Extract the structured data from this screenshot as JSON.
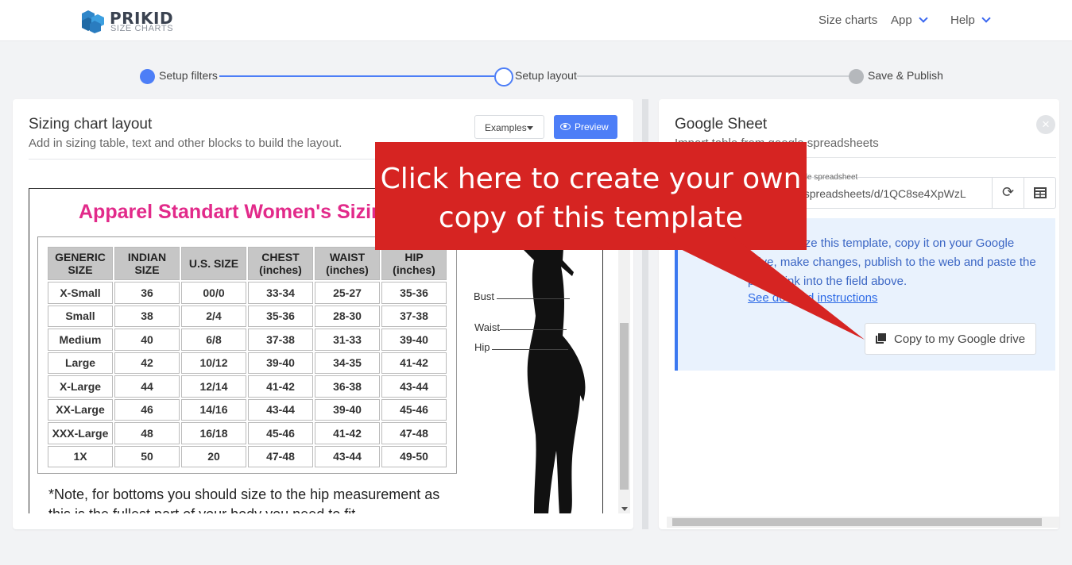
{
  "brand": {
    "name": "PRIKID",
    "tagline": "SIZE CHARTS"
  },
  "nav": {
    "size_charts": "Size charts",
    "app": "App",
    "help": "Help"
  },
  "steps": [
    {
      "label": "Setup filters",
      "state": "complete"
    },
    {
      "label": "Setup layout",
      "state": "active"
    },
    {
      "label": "Save & Publish",
      "state": "pending"
    }
  ],
  "layout_panel": {
    "title": "Sizing chart layout",
    "subtitle": "Add in sizing table, text and other blocks to build the layout.",
    "examples_label": "Examples",
    "preview_label": "Preview"
  },
  "size_chart": {
    "title": "Apparel Standart Women's Sizing",
    "headers": [
      "GENERIC SIZE",
      "INDIAN SIZE",
      "U.S. SIZE",
      "CHEST (inches)",
      "WAIST (inches)",
      "HIP (inches)"
    ],
    "rows": [
      [
        "X-Small",
        "36",
        "00/0",
        "33-34",
        "25-27",
        "35-36"
      ],
      [
        "Small",
        "38",
        "2/4",
        "35-36",
        "28-30",
        "37-38"
      ],
      [
        "Medium",
        "40",
        "6/8",
        "37-38",
        "31-33",
        "39-40"
      ],
      [
        "Large",
        "42",
        "10/12",
        "39-40",
        "34-35",
        "41-42"
      ],
      [
        "X-Large",
        "44",
        "12/14",
        "41-42",
        "36-38",
        "43-44"
      ],
      [
        "XX-Large",
        "46",
        "14/16",
        "43-44",
        "39-40",
        "45-46"
      ],
      [
        "XXX-Large",
        "48",
        "16/18",
        "45-46",
        "41-42",
        "47-48"
      ],
      [
        "1X",
        "50",
        "20",
        "47-48",
        "43-44",
        "49-50"
      ]
    ],
    "note": "*Note, for bottoms you should size to the hip measurement as",
    "note_cont": "this is the fullest part of your body you need to fit.",
    "body_labels": {
      "bust": "Bust",
      "waist": "Waist",
      "hip": "Hip"
    }
  },
  "sheet_panel": {
    "title": "Google Sheet",
    "subtitle": "Import table from google spreadsheets",
    "url_label": "Link to Google spreadsheet",
    "url_value": "https://docs.google.com/spreadsheets/d/1QC8se4XpWzL",
    "info_text": "To customize this template, copy it on your Google drive, make changes, publish to the web and paste the public link into the field above.",
    "info_link": "See detailed instructions",
    "copy_button": "Copy to my Google drive"
  },
  "callout": {
    "line1": "Click here to create your own",
    "line2": "copy of this template"
  },
  "colors": {
    "accent": "#4d7ef7",
    "callout": "#d62422",
    "chart_title": "#e22a8a"
  }
}
